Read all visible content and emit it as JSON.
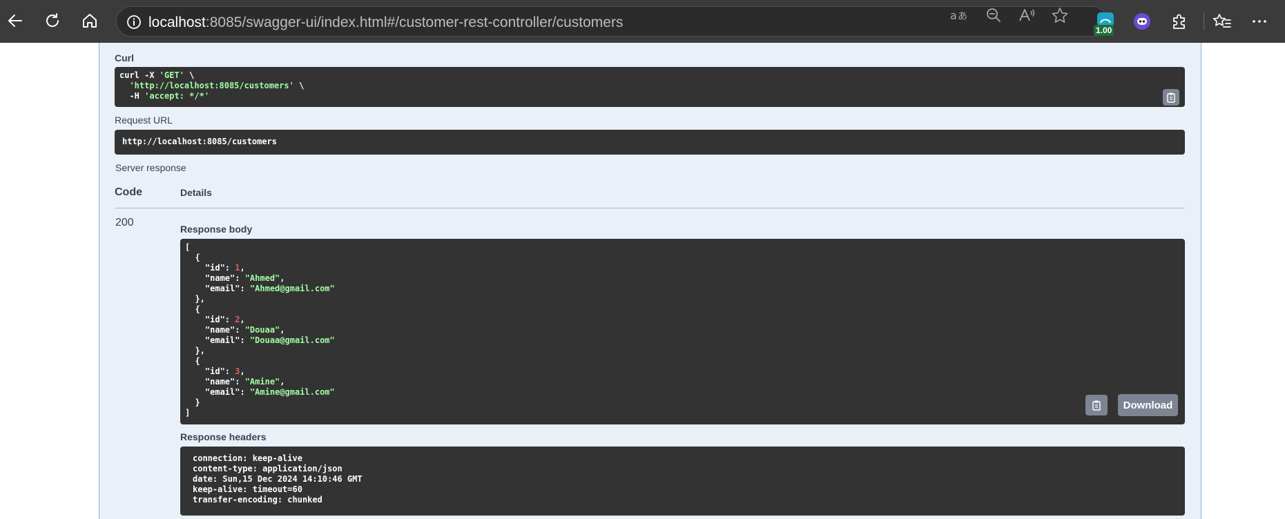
{
  "browser": {
    "url_host": "localhost",
    "url_rest": ":8085/swagger-ui/index.html#/customer-rest-controller/customers",
    "extension_badge": "1.00"
  },
  "curl": {
    "label": "Curl",
    "line1_cmd": "curl -X ",
    "line1_method": "'GET'",
    "line1_end": " \\",
    "line2_url": "  'http://localhost:8085/customers'",
    "line2_end": " \\",
    "line3_flag": "  -H ",
    "line3_header": "'accept: */*'"
  },
  "request_url": {
    "label": "Request URL",
    "value": "http://localhost:8085/customers"
  },
  "server_response": {
    "label": "Server response",
    "code_header": "Code",
    "details_header": "Details",
    "code": "200",
    "body_label": "Response body",
    "download_label": "Download",
    "customers": [
      {
        "id": "1",
        "name": "\"Ahmed\"",
        "email": "\"Ahmed@gmail.com\""
      },
      {
        "id": "2",
        "name": "\"Douaa\"",
        "email": "\"Douaa@gmail.com\""
      },
      {
        "id": "3",
        "name": "\"Amine\"",
        "email": "\"Amine@gmail.com\""
      }
    ],
    "headers_label": "Response headers",
    "headers": [
      "connection: keep-alive",
      "content-type: application/json",
      "date: Sun,15 Dec 2024 14:10:46 GMT",
      "keep-alive: timeout=60",
      "transfer-encoding: chunked"
    ]
  },
  "colors": {
    "string": "#a2fca2",
    "number": "#d36363",
    "panel_bg": "#e9f0f8",
    "code_bg": "#333333"
  }
}
